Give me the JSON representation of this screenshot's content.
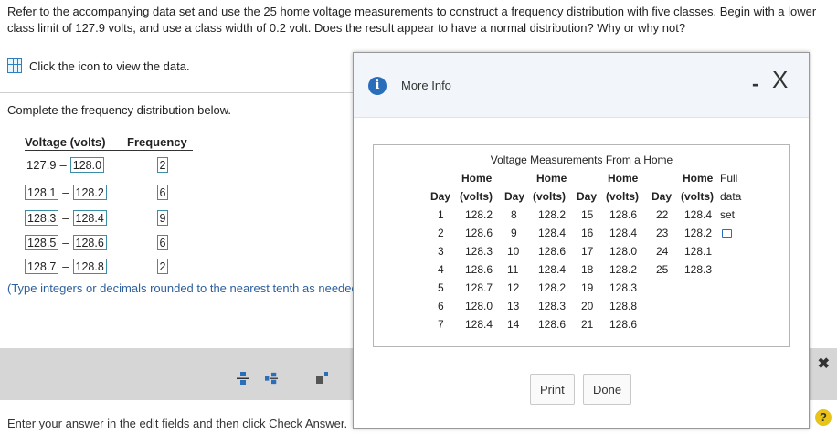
{
  "question": {
    "text": "Refer to the accompanying data set and use the 25 home voltage measurements to construct a frequency distribution with five classes. Begin with a lower class limit of 127.9 volts, and use a class width of 0.2 volt. Does the result appear to have a normal distribution? Why or why not?"
  },
  "data_link": {
    "label": "Click the icon to view the data."
  },
  "instruction": "Complete the frequency distribution below.",
  "freq_table": {
    "col_voltage": "Voltage (volts)",
    "col_frequency": "Frequency",
    "rows": [
      {
        "lower": "127.9",
        "upper": "128.0",
        "freq": "2"
      },
      {
        "lower": "128.1",
        "upper": "128.2",
        "freq": "6"
      },
      {
        "lower": "128.3",
        "upper": "128.4",
        "freq": "9"
      },
      {
        "lower": "128.5",
        "upper": "128.6",
        "freq": "6"
      },
      {
        "lower": "128.7",
        "upper": "128.8",
        "freq": "2"
      }
    ]
  },
  "hint": "(Type integers or decimals rounded to the nearest tenth as needed.)",
  "footer": {
    "text": "Enter your answer in the edit fields and then click Check Answer.",
    "help": "?"
  },
  "modal": {
    "title": "More Info",
    "minimize": "-",
    "close": "X",
    "data_title": "Voltage Measurements From a Home",
    "headers": {
      "day": "Day",
      "home": "Home",
      "volts": "(volts)",
      "home_full": "Home",
      "full": "Full",
      "data": "data",
      "set": "set"
    },
    "columns": [
      {
        "days": [
          "1",
          "2",
          "3",
          "4",
          "5",
          "6",
          "7"
        ],
        "volts": [
          "128.2",
          "128.6",
          "128.3",
          "128.6",
          "128.7",
          "128.0",
          "128.4"
        ]
      },
      {
        "days": [
          "8",
          "9",
          "10",
          "11",
          "12",
          "13",
          "14"
        ],
        "volts": [
          "128.2",
          "128.4",
          "128.6",
          "128.4",
          "128.2",
          "128.3",
          "128.6"
        ]
      },
      {
        "days": [
          "15",
          "16",
          "17",
          "18",
          "19",
          "20",
          "21"
        ],
        "volts": [
          "128.6",
          "128.4",
          "128.0",
          "128.2",
          "128.3",
          "128.8",
          "128.6"
        ]
      },
      {
        "days": [
          "22",
          "23",
          "24",
          "25"
        ],
        "volts": [
          "128.4",
          "128.2",
          "128.1",
          "128.3"
        ]
      }
    ],
    "print_label": "Print",
    "done_label": "Done"
  },
  "close_bar": "✖"
}
